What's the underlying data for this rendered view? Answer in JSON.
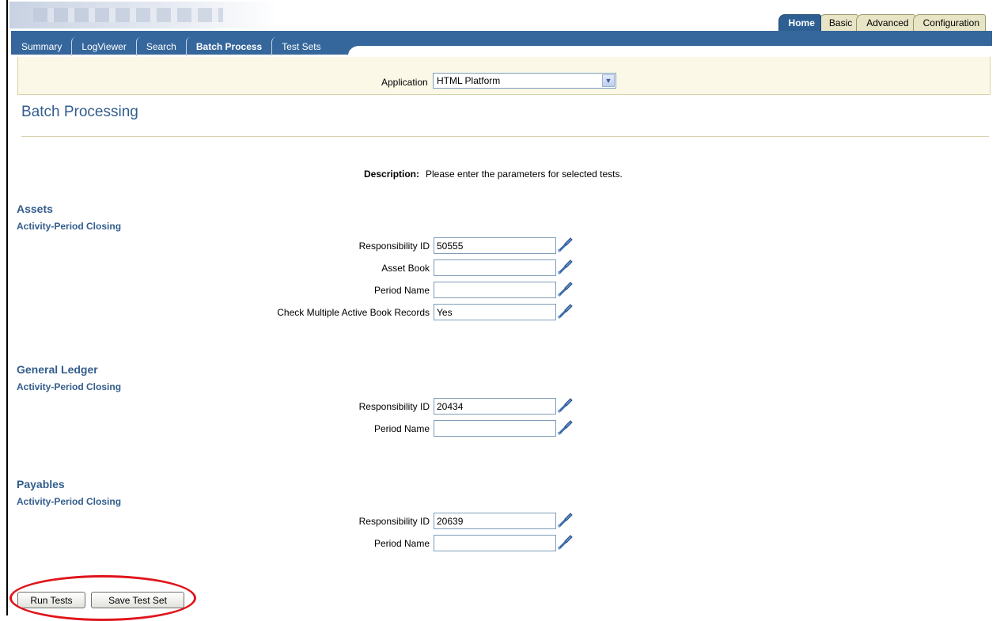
{
  "global_tabs": [
    {
      "label": "Home",
      "active": true
    },
    {
      "label": "Basic",
      "active": false
    },
    {
      "label": "Advanced",
      "active": false
    },
    {
      "label": "Configuration",
      "active": false
    }
  ],
  "sub_tabs": [
    {
      "label": "Summary",
      "active": false
    },
    {
      "label": "LogViewer",
      "active": false
    },
    {
      "label": "Search",
      "active": false
    },
    {
      "label": "Batch Process",
      "active": true
    },
    {
      "label": "Test Sets",
      "active": false
    }
  ],
  "application": {
    "label": "Application",
    "selected": "HTML Platform"
  },
  "page_title": "Batch Processing",
  "description": {
    "label": "Description:",
    "text": "Please enter the parameters for selected tests."
  },
  "sections": [
    {
      "title": "Assets",
      "subtitle": "Activity-Period Closing",
      "fields": [
        {
          "label": "Responsibility ID",
          "value": "50555"
        },
        {
          "label": "Asset Book",
          "value": ""
        },
        {
          "label": "Period Name",
          "value": ""
        },
        {
          "label": "Check Multiple Active Book Records",
          "value": "Yes"
        }
      ]
    },
    {
      "title": "General Ledger",
      "subtitle": "Activity-Period Closing",
      "fields": [
        {
          "label": "Responsibility ID",
          "value": "20434"
        },
        {
          "label": "Period Name",
          "value": ""
        }
      ]
    },
    {
      "title": "Payables",
      "subtitle": "Activity-Period Closing",
      "fields": [
        {
          "label": "Responsibility ID",
          "value": "20639"
        },
        {
          "label": "Period Name",
          "value": ""
        }
      ]
    }
  ],
  "buttons": {
    "run_tests": "Run Tests",
    "save_test_set": "Save Test Set"
  },
  "colors": {
    "header_blue": "#36679c",
    "title_blue": "#335d8d",
    "highlight_red": "#e0141b",
    "app_bar": "#fbf8e8"
  },
  "icons": {
    "lov": "flashlight-search-icon",
    "dropdown": "chevron-down-icon"
  }
}
